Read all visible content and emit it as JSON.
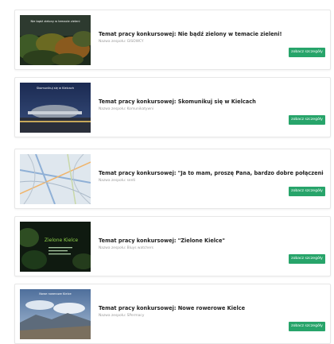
{
  "entries": [
    {
      "title": "Temat pracy konkursowej: Nie bądź zielony w temacie zieleni!",
      "team": "Nazwa zespołu: GISOWCY",
      "button": "zobacz szczegóły",
      "thumb_caption": "Nie bądź zielony w temacie zieleni",
      "icon": "forest-thumbnail"
    },
    {
      "title": "Temat pracy konkursowej: Skomunikuj się w Kielcach",
      "team": "Nazwa zespołu: Komunikatywni",
      "button": "zobacz szczegóły",
      "thumb_caption": "Skomunikuj się w Kielcach",
      "icon": "bus-station-thumbnail"
    },
    {
      "title": "Temat pracy konkursowej: \"Ja to mam, proszę Pana, bardzo dobre połączenie\"",
      "team": "Nazwa zespołu: senti",
      "button": "zobacz szczegóły",
      "thumb_caption": "",
      "icon": "city-map-thumbnail"
    },
    {
      "title": "Temat pracy konkursowej: \"Zielone Kielce\"",
      "team": "Nazwa zespołu: Bluys watchers",
      "button": "zobacz szczegóły",
      "thumb_caption": "Zielone Kielce",
      "icon": "green-city-thumbnail"
    },
    {
      "title": "Temat pracy konkursowej: Nowe rowerowe Kielce",
      "team": "Nazwa zespołu: SPermacy",
      "button": "zobacz szczegóły",
      "thumb_caption": "Nowe rowerowe Kielce",
      "icon": "cycling-thumbnail"
    }
  ],
  "colors": {
    "button": "#27a46a",
    "title": "#222222",
    "team": "#9a9a9a"
  }
}
